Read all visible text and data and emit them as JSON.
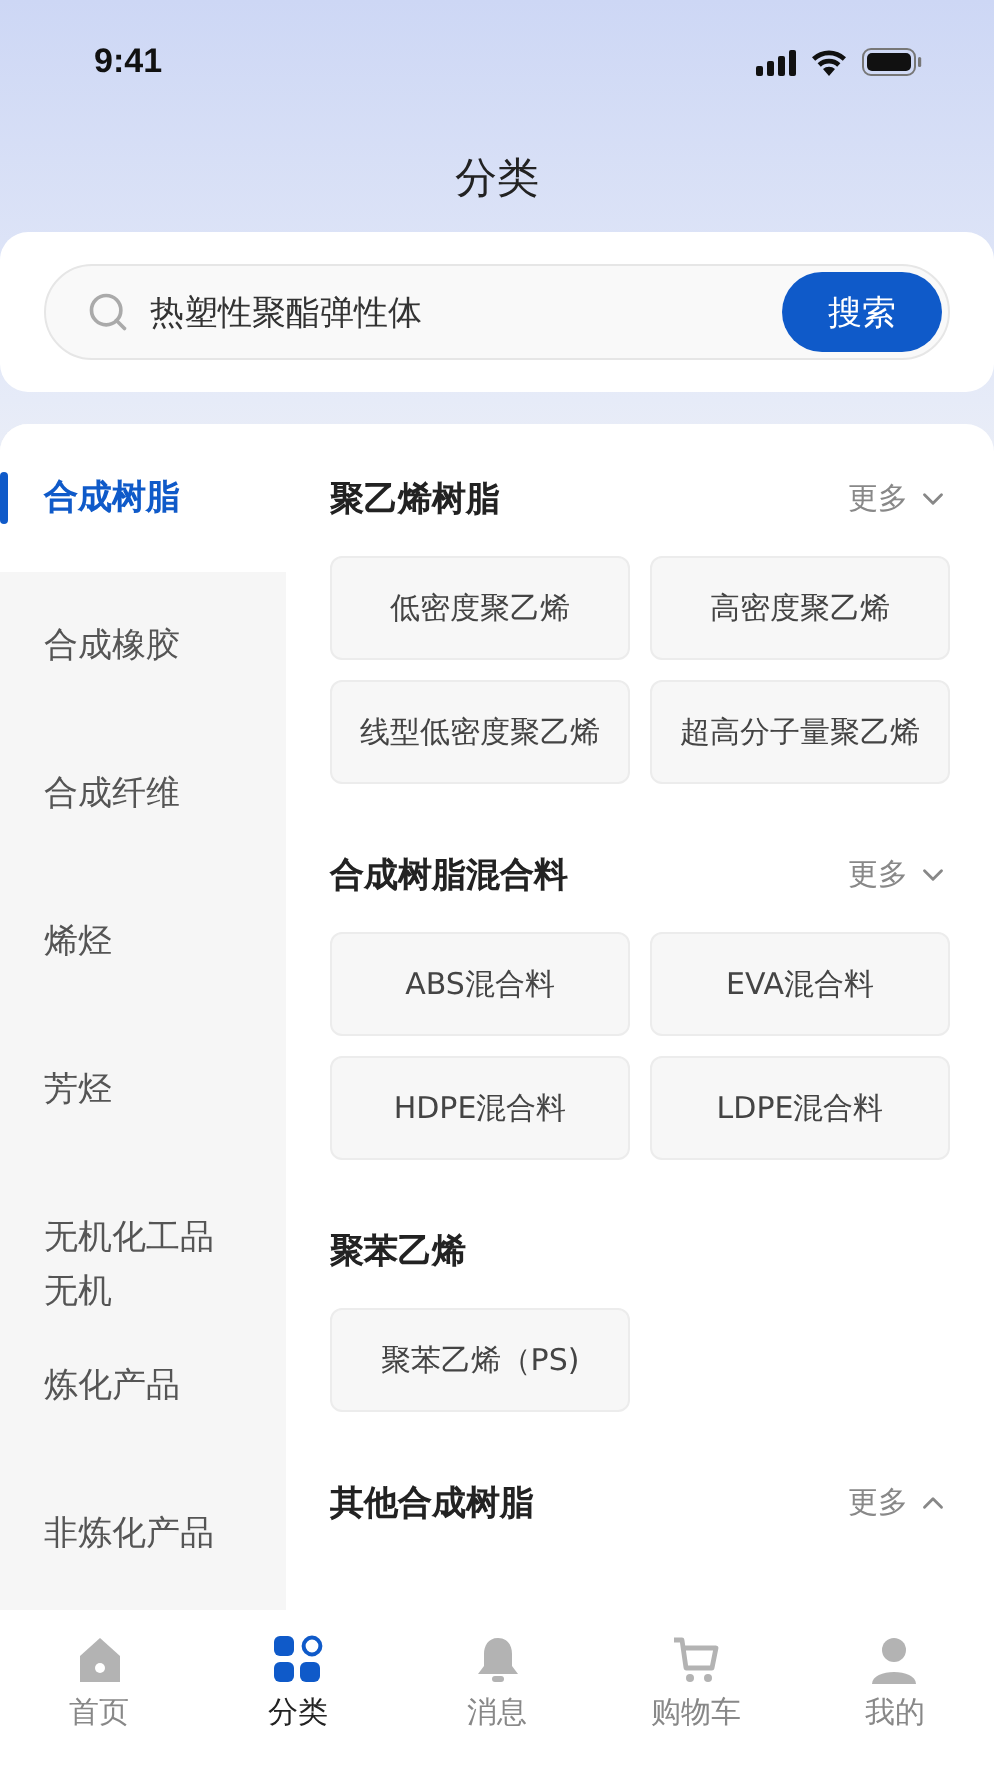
{
  "status_bar": {
    "time": "9:41"
  },
  "header": {
    "title": "分类"
  },
  "search": {
    "value": "热塑性聚酯弹性体",
    "button": "搜索"
  },
  "sidebar": {
    "items": [
      {
        "label": "合成树脂",
        "selected": true
      },
      {
        "label": "合成橡胶",
        "selected": false
      },
      {
        "label": "合成纤维",
        "selected": false
      },
      {
        "label": "烯烃",
        "selected": false
      },
      {
        "label": "芳烃",
        "selected": false
      },
      {
        "label": "无机化工品无机",
        "selected": false
      },
      {
        "label": "炼化产品",
        "selected": false
      },
      {
        "label": "非炼化产品",
        "selected": false
      }
    ]
  },
  "sections": [
    {
      "title": "聚乙烯树脂",
      "more": "更多",
      "expanded": false,
      "items": [
        "低密度聚乙烯",
        "高密度聚乙烯",
        "线型低密度聚乙烯",
        "超高分子量聚乙烯"
      ]
    },
    {
      "title": "合成树脂混合料",
      "more": "更多",
      "expanded": false,
      "items": [
        "ABS混合料",
        "EVA混合料",
        "HDPE混合料",
        "LDPE混合料"
      ]
    },
    {
      "title": "聚苯乙烯",
      "items": [
        "聚苯乙烯（PS)"
      ]
    },
    {
      "title": "其他合成树脂",
      "more": "更多",
      "expanded": true
    }
  ],
  "tab_bar": {
    "items": [
      {
        "label": "首页",
        "kind": "home",
        "selected": false
      },
      {
        "label": "分类",
        "kind": "category",
        "selected": true
      },
      {
        "label": "消息",
        "kind": "message",
        "selected": false
      },
      {
        "label": "购物车",
        "kind": "cart",
        "selected": false
      },
      {
        "label": "我的",
        "kind": "profile",
        "selected": false
      }
    ]
  }
}
